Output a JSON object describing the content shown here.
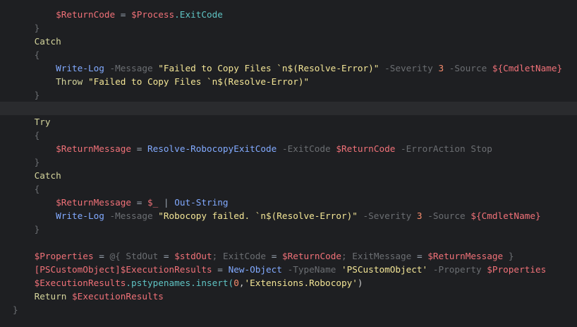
{
  "editor": {
    "lines": [
      {
        "tokens": [
          {
            "t": "        ",
            "c": "plain"
          },
          {
            "t": "$ReturnCode",
            "c": "var"
          },
          {
            "t": " = ",
            "c": "op"
          },
          {
            "t": "$Process",
            "c": "var"
          },
          {
            "t": ".ExitCode",
            "c": "prop"
          }
        ]
      },
      {
        "tokens": [
          {
            "t": "    ",
            "c": "plain"
          },
          {
            "t": "}",
            "c": "brace"
          }
        ]
      },
      {
        "tokens": [
          {
            "t": "    ",
            "c": "plain"
          },
          {
            "t": "Catch",
            "c": "kw"
          }
        ]
      },
      {
        "tokens": [
          {
            "t": "    ",
            "c": "plain"
          },
          {
            "t": "{",
            "c": "brace"
          }
        ]
      },
      {
        "tokens": [
          {
            "t": "        ",
            "c": "plain"
          },
          {
            "t": "Write-Log",
            "c": "cmd"
          },
          {
            "t": " ",
            "c": "plain"
          },
          {
            "t": "-Message",
            "c": "param"
          },
          {
            "t": " ",
            "c": "plain"
          },
          {
            "t": "\"Failed to Copy Files `n$(Resolve-Error)\"",
            "c": "str"
          },
          {
            "t": " ",
            "c": "plain"
          },
          {
            "t": "-Severity",
            "c": "param"
          },
          {
            "t": " ",
            "c": "plain"
          },
          {
            "t": "3",
            "c": "num"
          },
          {
            "t": " ",
            "c": "plain"
          },
          {
            "t": "-Source",
            "c": "param"
          },
          {
            "t": " ",
            "c": "plain"
          },
          {
            "t": "${CmdletName}",
            "c": "var"
          }
        ]
      },
      {
        "tokens": [
          {
            "t": "        ",
            "c": "plain"
          },
          {
            "t": "Throw",
            "c": "kw"
          },
          {
            "t": " ",
            "c": "plain"
          },
          {
            "t": "\"Failed to Copy Files `n$(Resolve-Error)\"",
            "c": "str"
          }
        ]
      },
      {
        "tokens": [
          {
            "t": "    ",
            "c": "plain"
          },
          {
            "t": "}",
            "c": "brace"
          }
        ]
      },
      {
        "tokens": [],
        "current": true
      },
      {
        "tokens": [
          {
            "t": "    ",
            "c": "plain"
          },
          {
            "t": "Try",
            "c": "kw"
          }
        ]
      },
      {
        "tokens": [
          {
            "t": "    ",
            "c": "plain"
          },
          {
            "t": "{",
            "c": "brace"
          }
        ]
      },
      {
        "tokens": [
          {
            "t": "        ",
            "c": "plain"
          },
          {
            "t": "$ReturnMessage",
            "c": "var"
          },
          {
            "t": " = ",
            "c": "op"
          },
          {
            "t": "Resolve-RobocopyExitCode",
            "c": "cmd"
          },
          {
            "t": " ",
            "c": "plain"
          },
          {
            "t": "-ExitCode",
            "c": "param"
          },
          {
            "t": " ",
            "c": "plain"
          },
          {
            "t": "$ReturnCode",
            "c": "var"
          },
          {
            "t": " ",
            "c": "plain"
          },
          {
            "t": "-ErrorAction Stop",
            "c": "param"
          }
        ]
      },
      {
        "tokens": [
          {
            "t": "    ",
            "c": "plain"
          },
          {
            "t": "}",
            "c": "brace"
          }
        ]
      },
      {
        "tokens": [
          {
            "t": "    ",
            "c": "plain"
          },
          {
            "t": "Catch",
            "c": "kw"
          }
        ]
      },
      {
        "tokens": [
          {
            "t": "    ",
            "c": "plain"
          },
          {
            "t": "{",
            "c": "brace"
          }
        ]
      },
      {
        "tokens": [
          {
            "t": "        ",
            "c": "plain"
          },
          {
            "t": "$ReturnMessage",
            "c": "var"
          },
          {
            "t": " = ",
            "c": "op"
          },
          {
            "t": "$_",
            "c": "var"
          },
          {
            "t": " | ",
            "c": "op"
          },
          {
            "t": "Out-String",
            "c": "cmd"
          }
        ]
      },
      {
        "tokens": [
          {
            "t": "        ",
            "c": "plain"
          },
          {
            "t": "Write-Log",
            "c": "cmd"
          },
          {
            "t": " ",
            "c": "plain"
          },
          {
            "t": "-Message",
            "c": "param"
          },
          {
            "t": " ",
            "c": "plain"
          },
          {
            "t": "\"Robocopy failed. `n$(Resolve-Error)\"",
            "c": "str"
          },
          {
            "t": " ",
            "c": "plain"
          },
          {
            "t": "-Severity",
            "c": "param"
          },
          {
            "t": " ",
            "c": "plain"
          },
          {
            "t": "3",
            "c": "num"
          },
          {
            "t": " ",
            "c": "plain"
          },
          {
            "t": "-Source",
            "c": "param"
          },
          {
            "t": " ",
            "c": "plain"
          },
          {
            "t": "${CmdletName}",
            "c": "var"
          }
        ]
      },
      {
        "tokens": [
          {
            "t": "    ",
            "c": "plain"
          },
          {
            "t": "}",
            "c": "brace"
          }
        ]
      },
      {
        "tokens": []
      },
      {
        "tokens": [
          {
            "t": "    ",
            "c": "plain"
          },
          {
            "t": "$Properties",
            "c": "var"
          },
          {
            "t": " = ",
            "c": "op"
          },
          {
            "t": "@{",
            "c": "dim"
          },
          {
            "t": " StdOut ",
            "c": "dim"
          },
          {
            "t": "=",
            "c": "op"
          },
          {
            "t": " ",
            "c": "plain"
          },
          {
            "t": "$stdOut",
            "c": "var"
          },
          {
            "t": "; ExitCode ",
            "c": "dim"
          },
          {
            "t": "=",
            "c": "op"
          },
          {
            "t": " ",
            "c": "plain"
          },
          {
            "t": "$ReturnCode",
            "c": "var"
          },
          {
            "t": "; ExitMessage ",
            "c": "dim"
          },
          {
            "t": "=",
            "c": "op"
          },
          {
            "t": " ",
            "c": "plain"
          },
          {
            "t": "$ReturnMessage",
            "c": "var"
          },
          {
            "t": " }",
            "c": "dim"
          }
        ]
      },
      {
        "tokens": [
          {
            "t": "    ",
            "c": "plain"
          },
          {
            "t": "[PSCustomObject]",
            "c": "type"
          },
          {
            "t": "$ExecutionResults",
            "c": "var"
          },
          {
            "t": " = ",
            "c": "op"
          },
          {
            "t": "New-Object",
            "c": "cmd"
          },
          {
            "t": " ",
            "c": "plain"
          },
          {
            "t": "-TypeName",
            "c": "param"
          },
          {
            "t": " ",
            "c": "plain"
          },
          {
            "t": "'PSCustomObject'",
            "c": "str"
          },
          {
            "t": " ",
            "c": "plain"
          },
          {
            "t": "-Property",
            "c": "param"
          },
          {
            "t": " ",
            "c": "plain"
          },
          {
            "t": "$Properties",
            "c": "var"
          }
        ]
      },
      {
        "tokens": [
          {
            "t": "    ",
            "c": "plain"
          },
          {
            "t": "$ExecutionResults",
            "c": "var"
          },
          {
            "t": ".pstypenames.insert(",
            "c": "prop"
          },
          {
            "t": "0",
            "c": "num"
          },
          {
            "t": ",",
            "c": "plain"
          },
          {
            "t": "'Extensions.Robocopy'",
            "c": "str"
          },
          {
            "t": ")",
            "c": "plain"
          }
        ]
      },
      {
        "tokens": [
          {
            "t": "    ",
            "c": "plain"
          },
          {
            "t": "Return",
            "c": "kw"
          },
          {
            "t": " ",
            "c": "plain"
          },
          {
            "t": "$ExecutionResults",
            "c": "var"
          }
        ]
      },
      {
        "tokens": [
          {
            "t": "}",
            "c": "brace"
          }
        ]
      }
    ]
  }
}
